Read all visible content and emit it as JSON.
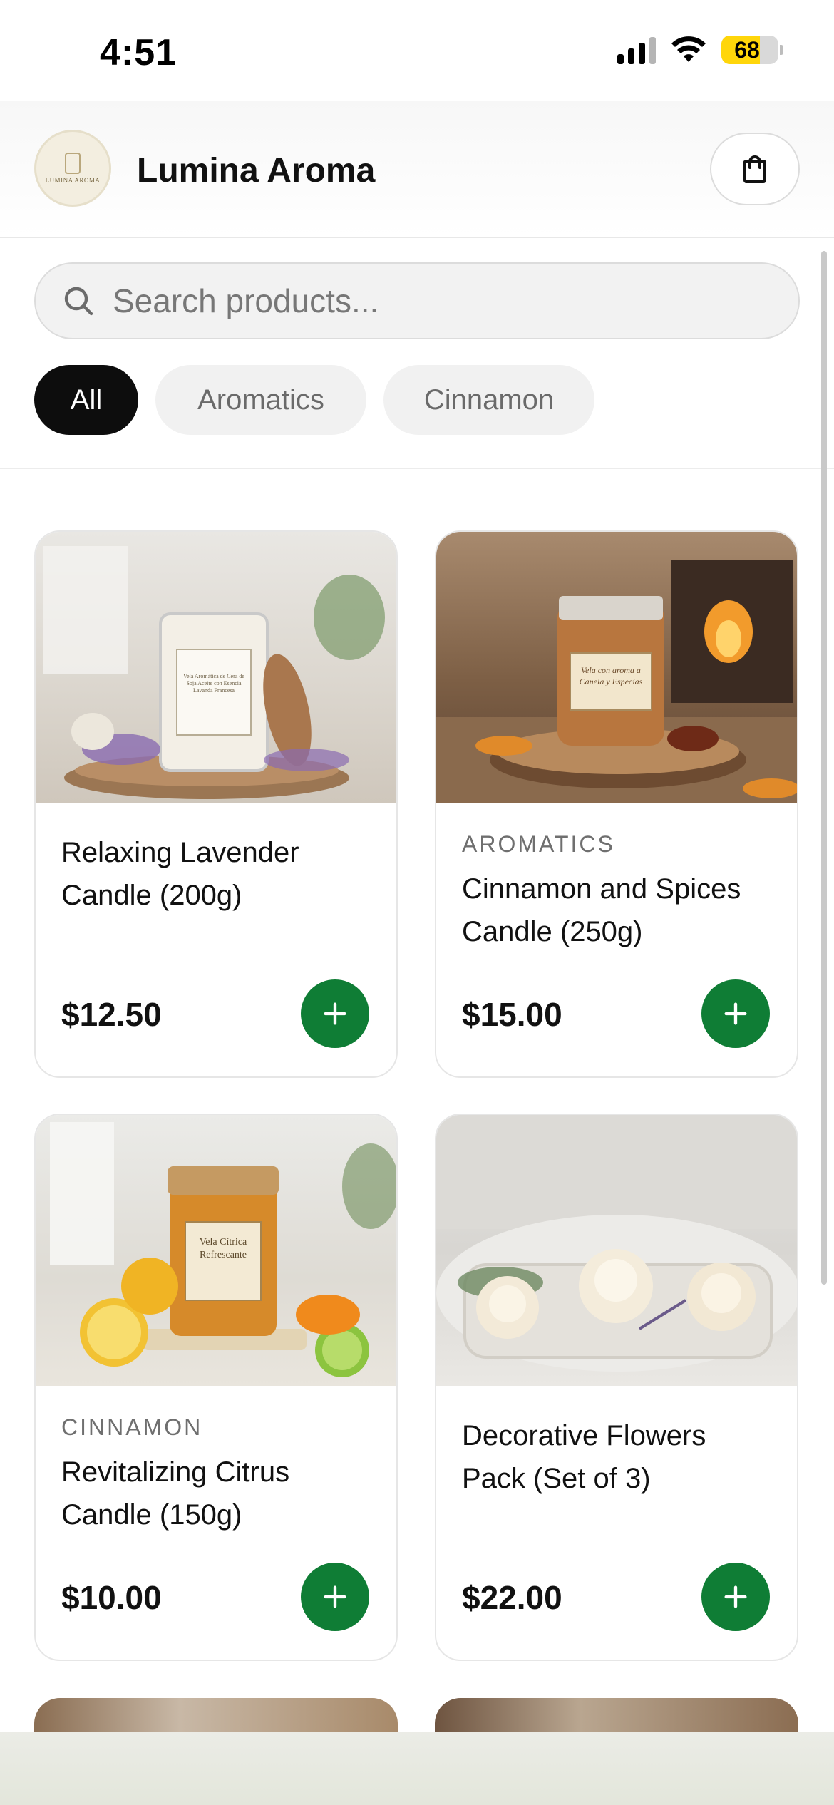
{
  "status_bar": {
    "time": "4:51",
    "battery_level": "68",
    "battery_fraction": 0.68,
    "signal_icon": "cellular-signal-icon",
    "wifi_icon": "wifi-icon"
  },
  "header": {
    "brand_name": "Lumina Aroma",
    "logo_text": "LUMINA AROMA",
    "cart_icon": "shopping-bag-icon"
  },
  "search": {
    "placeholder": "Search products...",
    "value": "",
    "icon": "search-icon"
  },
  "filters": {
    "chips": [
      {
        "label": "All",
        "active": true
      },
      {
        "label": "Aromatics",
        "active": false
      },
      {
        "label": "Cinnamon",
        "active": false
      }
    ]
  },
  "products": [
    {
      "category": "",
      "name": "Relaxing Lavender Candle (200g)",
      "price": "$12.50",
      "image": "lavender-candle-photo",
      "jar_label": "Vela Aromática de Cera de Soja Aceite con Esencia Lavanda Francesa"
    },
    {
      "category": "AROMATICS",
      "name": "Cinnamon and Spices Candle (250g)",
      "price": "$15.00",
      "image": "cinnamon-candle-photo",
      "jar_label": "Vela con aroma a Canela y Especias"
    },
    {
      "category": "CINNAMON",
      "name": "Revitalizing Citrus Candle (150g)",
      "price": "$10.00",
      "image": "citrus-candle-photo",
      "jar_label": "Vela Cítrica Refrescante"
    },
    {
      "category": "",
      "name": "Decorative Flowers Pack (Set of 3)",
      "price": "$22.00",
      "image": "flower-candles-photo",
      "jar_label": ""
    }
  ],
  "colors": {
    "accent_green": "#0f7d35",
    "active_chip": "#0d0d0d",
    "battery_yellow": "#ffd60a"
  }
}
